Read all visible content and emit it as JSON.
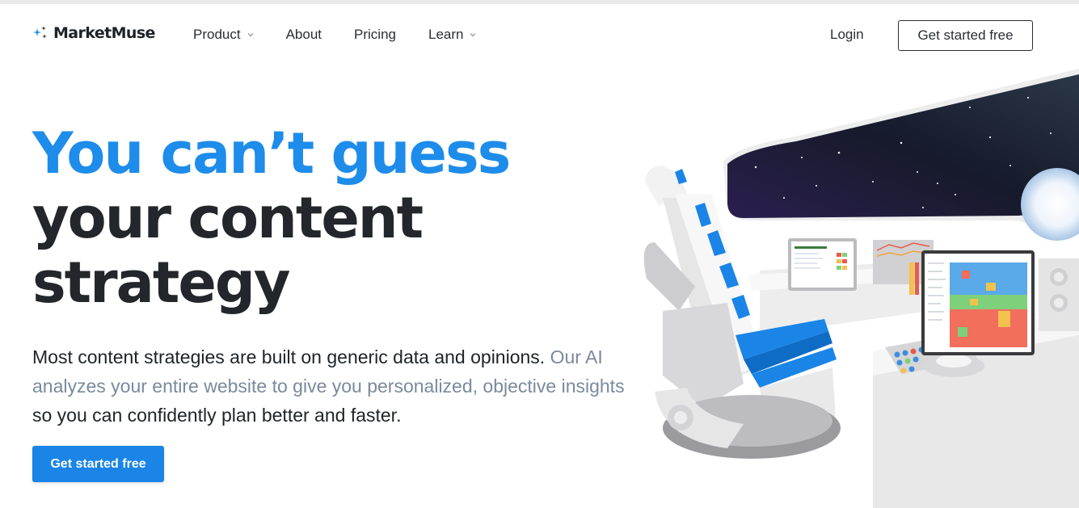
{
  "brand": {
    "name": "MarketMuse",
    "logo_icon": "sparkle-icon",
    "accent": "#1e8cea"
  },
  "nav": {
    "items": [
      {
        "label": "Product",
        "has_dropdown": true
      },
      {
        "label": "About",
        "has_dropdown": false
      },
      {
        "label": "Pricing",
        "has_dropdown": false
      },
      {
        "label": "Learn",
        "has_dropdown": true
      }
    ],
    "login": "Login",
    "cta": "Get started free"
  },
  "hero": {
    "headline_line1": "You can’t guess",
    "headline_line2": "your content",
    "headline_line3": "strategy",
    "lede_part1": "Most content strategies are built on generic data and opinions. ",
    "lede_highlight": "Our AI analyzes your entire website to give you personalized, objective insights",
    "lede_part2": " so you can confidently plan better and faster.",
    "cta": "Get started free",
    "cta_color": "#1a85e6"
  }
}
